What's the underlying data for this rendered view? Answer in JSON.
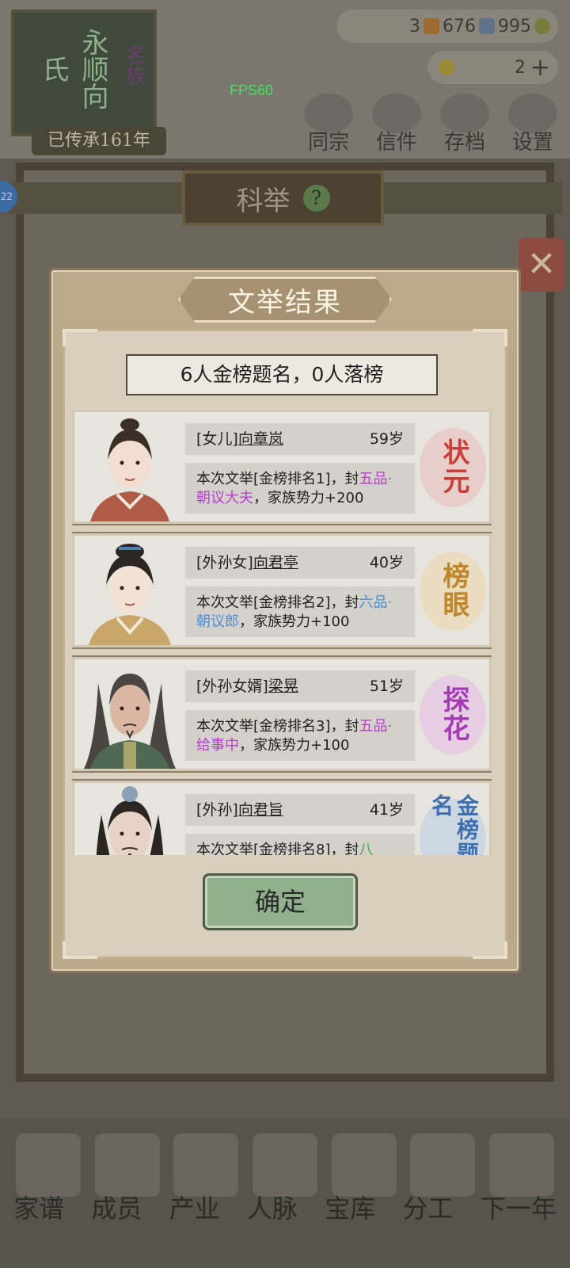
{
  "background": {
    "clan": {
      "surname": "永顺向氏",
      "tag": "名族",
      "generation": "已传承161年"
    },
    "resources": {
      "first": "3",
      "second": "676",
      "third": "995",
      "coins": "2"
    },
    "fps": "FPS60",
    "top_nav": [
      "同宗",
      "信件",
      "存档",
      "设置"
    ],
    "screen_title": "科举",
    "help_icon": "?",
    "side_badge": "22",
    "bottom_nav": [
      "家谱",
      "成员",
      "产业",
      "人脉",
      "宝库",
      "分工",
      "下一年"
    ]
  },
  "dialog": {
    "title": "文举结果",
    "summary": "6人金榜题名，0人落榜",
    "results": [
      {
        "relation": "[女儿]",
        "name": "向章岚",
        "age": "59岁",
        "desc_prefix": "本次文举[金榜排名1]，封",
        "rank_title": "五品·朝议大夫",
        "desc_suffix": "，家族势力+200",
        "seal": "状元",
        "seal_color": "#c8403c"
      },
      {
        "relation": "[外孙女]",
        "name": "向君亭",
        "age": "40岁",
        "desc_prefix": "本次文举[金榜排名2]，封",
        "rank_title": "六品·朝议郎",
        "desc_suffix": "，家族势力+100",
        "seal": "榜眼",
        "seal_color": "#c0852a"
      },
      {
        "relation": "[外孙女婿]",
        "name": "梁晃",
        "age": "51岁",
        "desc_prefix": "本次文举[金榜排名3]，封",
        "rank_title": "五品·给事中",
        "desc_suffix": "，家族势力+100",
        "seal": "探花",
        "seal_color": "#a63bb8"
      },
      {
        "relation": "[外孙]",
        "name": "向君旨",
        "age": "41岁",
        "desc_prefix": "本次文举[金榜排名8]，封",
        "rank_title": "八",
        "desc_suffix": "",
        "seal": "金榜题名",
        "seal_color": "#3e6fae"
      }
    ],
    "confirm_label": "确定"
  }
}
